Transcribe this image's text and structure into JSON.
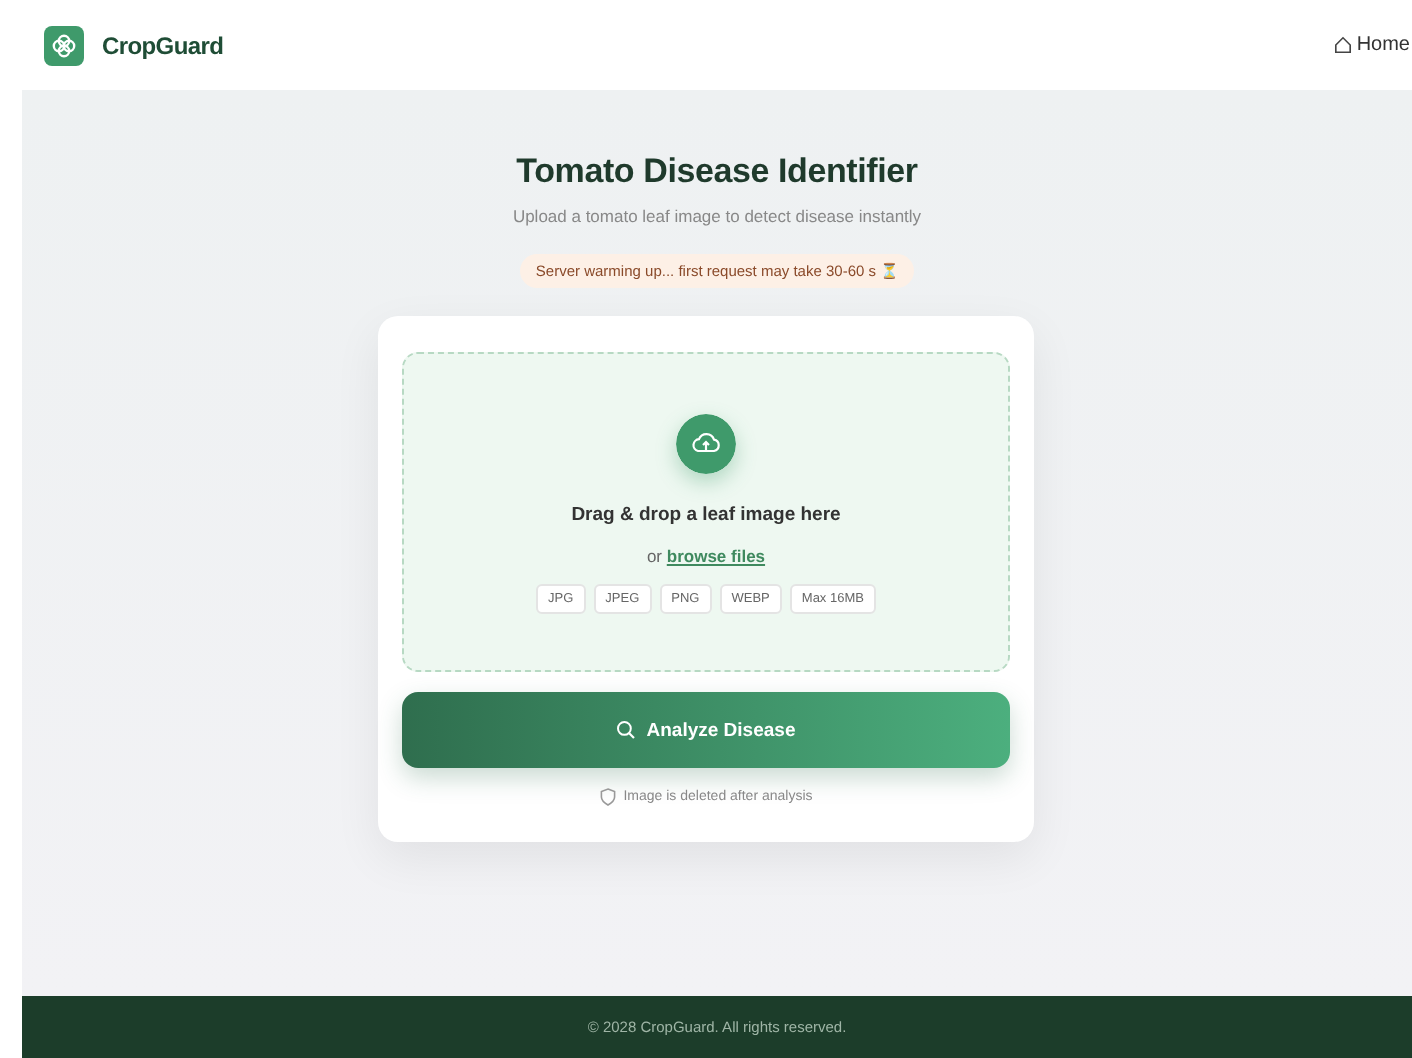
{
  "header": {
    "brand": "CropGuard",
    "nav": [
      {
        "label": "Home"
      }
    ]
  },
  "hero": {
    "title": "Tomato Disease Identifier",
    "subtitle": "Upload a tomato leaf image to detect disease instantly",
    "notice": "Server warming up... first request may take 30-60 s ⏳"
  },
  "upload": {
    "prompt": "Drag & drop a leaf image here",
    "or": "or",
    "link": "browse files",
    "formats": [
      "JPG",
      "JPEG",
      "PNG",
      "WEBP",
      "Max 16MB"
    ]
  },
  "action": {
    "label": "Analyze Disease",
    "note": "Image is deleted after analysis"
  },
  "footer": {
    "text": "© 2028 CropGuard. All rights reserved."
  }
}
